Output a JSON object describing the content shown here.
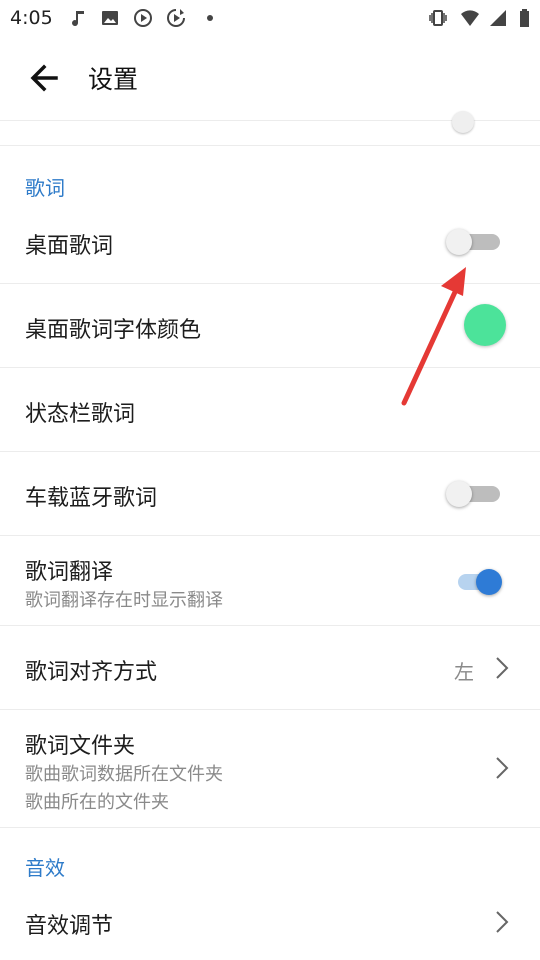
{
  "status_bar": {
    "time": "4:05",
    "left_icons": [
      "music-note-icon",
      "image-icon",
      "play-circle-icon",
      "sync-play-icon",
      "dot-icon"
    ],
    "right_icons": [
      "vibrate-icon",
      "wifi-icon",
      "cellular-signal-icon",
      "battery-icon"
    ]
  },
  "appbar": {
    "title": "设置",
    "back_icon": "arrow-left-icon"
  },
  "sections": {
    "lyrics": "歌词",
    "effects": "音效"
  },
  "rows": {
    "desktop_lyrics": {
      "label": "桌面歌词",
      "toggle": false
    },
    "desktop_font_color": {
      "label": "桌面歌词字体颜色",
      "color": "#4ce39a"
    },
    "status_bar_lyrics": {
      "label": "状态栏歌词"
    },
    "car_bluetooth": {
      "label": "车载蓝牙歌词",
      "toggle": false
    },
    "translation": {
      "label": "歌词翻译",
      "sub": "歌词翻译存在时显示翻译",
      "toggle": true
    },
    "alignment": {
      "label": "歌词对齐方式",
      "value": "左"
    },
    "folder": {
      "label": "歌词文件夹",
      "sub1": "歌曲歌词数据所在文件夹",
      "sub2": "歌曲所在的文件夹"
    },
    "eq": {
      "label": "音效调节"
    }
  },
  "colors": {
    "accent": "#2e7bc9",
    "annotation_arrow": "#e53935"
  }
}
